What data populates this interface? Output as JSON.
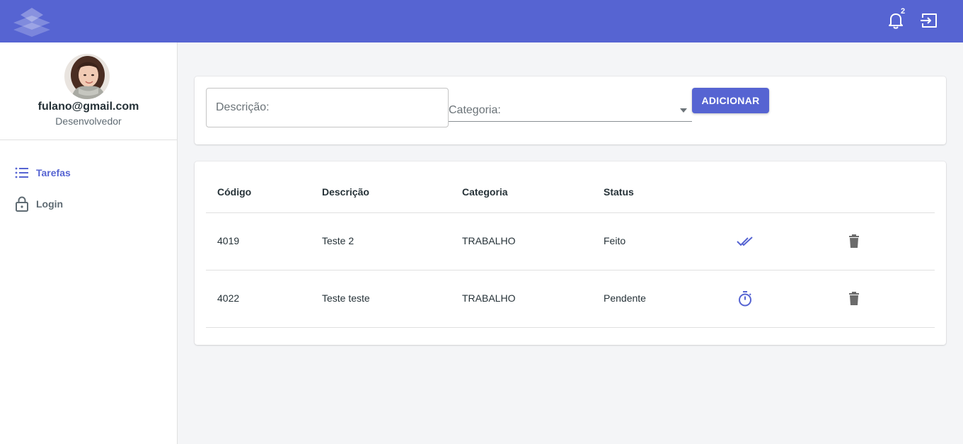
{
  "header": {
    "notifications_count": "2",
    "bar_color": "#5664d2"
  },
  "user": {
    "email": "fulano@gmail.com",
    "role": "Desenvolvedor"
  },
  "nav": {
    "items": [
      {
        "label": "Tarefas",
        "icon": "list-icon",
        "active": true
      },
      {
        "label": "Login",
        "icon": "lock-icon",
        "active": false
      }
    ]
  },
  "form": {
    "description_placeholder": "Descrição:",
    "description_value": "",
    "category_label": "Categoria:",
    "add_label": "ADICIONAR"
  },
  "table": {
    "columns": [
      "Código",
      "Descrição",
      "Categoria",
      "Status"
    ],
    "rows": [
      {
        "code": "4019",
        "description": "Teste 2",
        "category": "TRABALHO",
        "status": "Feito",
        "status_icon": "done-all-icon"
      },
      {
        "code": "4022",
        "description": "Teste teste",
        "category": "TRABALHO",
        "status": "Pendente",
        "status_icon": "timer-icon"
      }
    ]
  },
  "colors": {
    "accent": "#5664d2",
    "trash": "#6b6b6b"
  }
}
